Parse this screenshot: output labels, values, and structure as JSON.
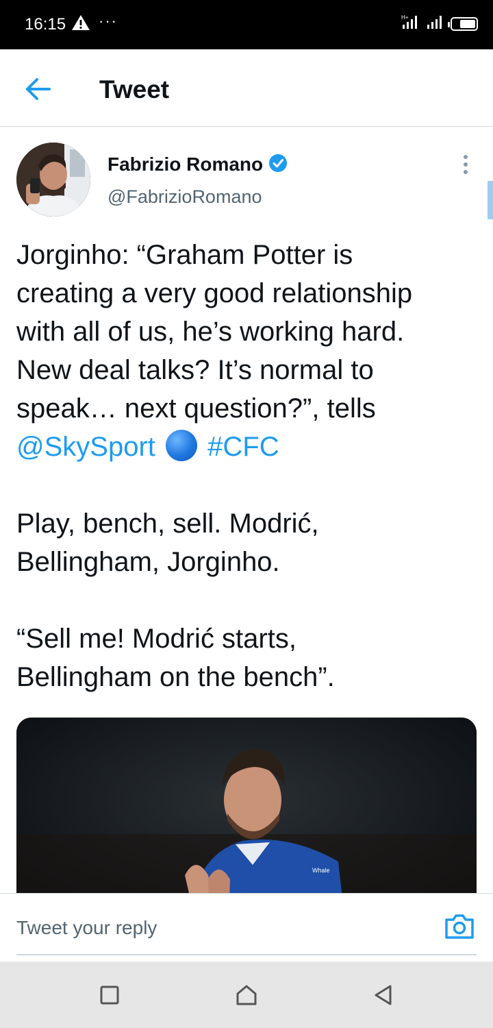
{
  "status_bar": {
    "time": "16:15",
    "alert_icon": "warning-icon",
    "dots": "···",
    "signal_icons": [
      "lte-signal-icon",
      "signal-icon",
      "battery-icon"
    ],
    "battery_level": 0.7
  },
  "header": {
    "back_icon": "arrow-left-icon",
    "title": "Tweet"
  },
  "tweet": {
    "author_name": "Fabrizio Romano",
    "author_handle": "@FabrizioRomano",
    "verified_icon": "verified-badge-icon",
    "more_icon": "more-vertical-icon",
    "text_lines": [
      "Jorginho: “Graham Potter is",
      "creating a very good relationship",
      "with all of us, he’s working hard.",
      "New deal talks? It’s normal to",
      "speak… next question?”, tells"
    ],
    "mention": "@SkySport",
    "emoji_icon": "blue-circle-emoji",
    "hashtag": "#CFC",
    "paragraph2_lines": [
      "Play, bench, sell. Modrić,",
      "Bellingham, Jorginho."
    ],
    "paragraph3_lines": [
      "“Sell me! Modrić starts,",
      "Bellingham on the bench”."
    ],
    "media_label": "Whale"
  },
  "reply": {
    "placeholder": "Tweet your reply",
    "camera_icon": "camera-icon"
  },
  "nav_bar": {
    "icons": [
      "recents-square-icon",
      "home-icon",
      "back-triangle-icon"
    ]
  },
  "colors": {
    "accent": "#1d9bf0",
    "text": "#0f1419",
    "secondary": "#536471"
  }
}
